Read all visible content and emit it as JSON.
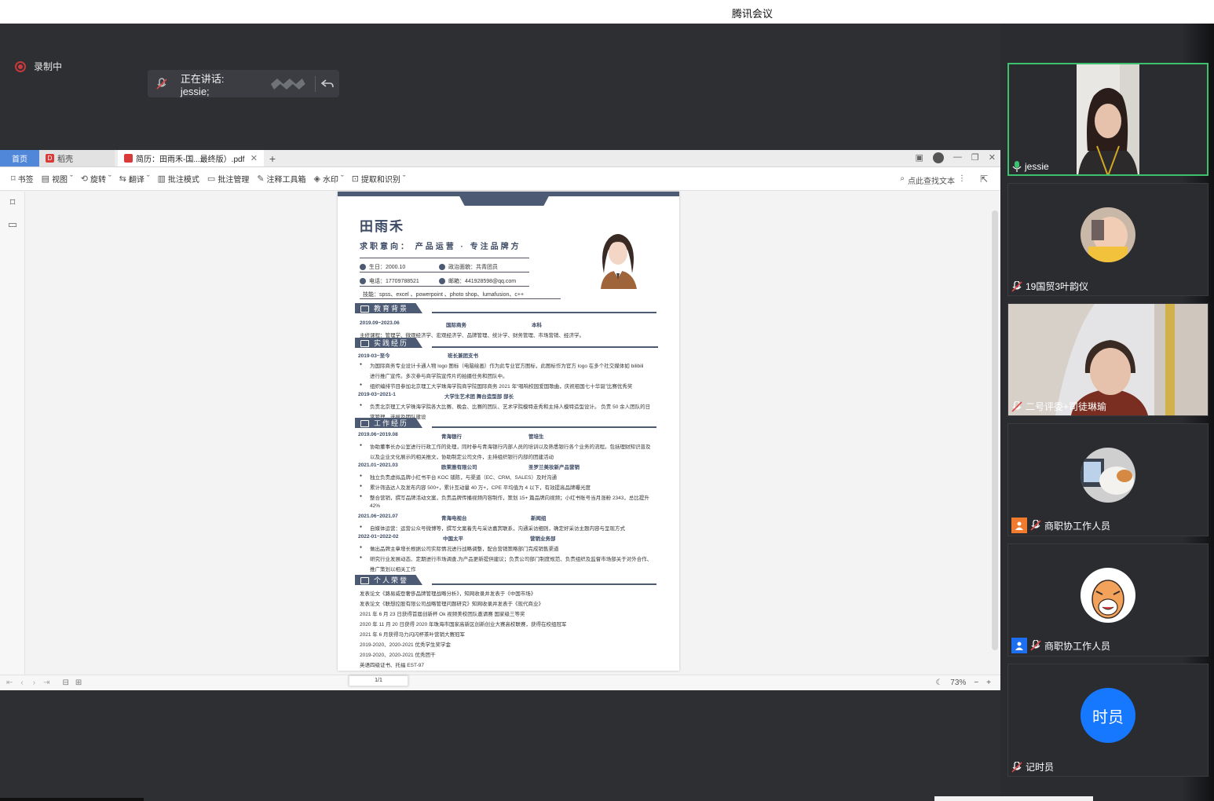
{
  "app": {
    "title": "腾讯会议"
  },
  "recording": {
    "label": "录制中"
  },
  "speaking": {
    "label": "正在讲话: jessie;"
  },
  "viewer": {
    "tabs": {
      "home": "首页",
      "daoke": "稻壳",
      "pdf": "简历：田雨禾-国...最终版）.pdf"
    },
    "toolbar": {
      "bookmark": "书签",
      "view": "视图",
      "rotate": "旋转",
      "translate": "翻译",
      "annotate_mode": "批注模式",
      "annotate_manage": "批注管理",
      "annotate_tools": "注释工具箱",
      "watermark": "水印",
      "extract": "提取和识别",
      "search": "点此查找文本"
    },
    "status": {
      "page": "1/1",
      "zoom": "73%"
    }
  },
  "resume": {
    "name": "田雨禾",
    "intent": "求职意向：  产品运营 · 专注品牌方",
    "birth": "生日：2000.10",
    "politics": "政治面貌：共青团员",
    "phone": "电话：17709788521",
    "email": "邮箱：441928598@qq.com",
    "skills": "技能：spss、excel 、powerpoint 、photo shop、lumafusion、c++",
    "sections": {
      "education": "教育背景",
      "practice": "实践经历",
      "work": "工作经历",
      "honors": "个人荣誉"
    },
    "edu": {
      "period": "2019.09~2023.06",
      "major": "国际商务",
      "degree": "本科",
      "courses": "主修课程：管理学、微观经济学、宏观经济学、品牌管理、统计学、财务管理、市场营销、经济学。"
    },
    "practice": [
      {
        "period": "2019-03~至今",
        "role": "班长兼团支书"
      },
      {
        "text1": "为国际商务专业设计卡通人物 logo 图标（电脑绘画）作为此专业官方图标，此图标作为官方 logo 在多个社交媒体如 bilibili"
      },
      {
        "text2": "进行推广宣传。多次参与商学院宣传片的拍摄任务和团队中。"
      },
      {
        "text3": "组织编排节目参加北京理工大学珠海学院商学院国际商务 2021 年“唱响校园爱国歌曲，庆祝祖国七十华诞”比赛优秀奖"
      },
      {
        "period": "2019-03~2021-1",
        "role": "大学生艺术团  舞台造型部  部长"
      },
      {
        "text4": "负责北京理工大学珠海学院各大比赛、晚会、比赛的团队、艺术学院模特走秀和主持人模特造型设计。  负责 50 余人团队的日"
      },
      {
        "text5": "常管理、选拔及团队建设"
      }
    ],
    "work": [
      {
        "period": "2019.06~2019.08",
        "company": "青海银行",
        "role": "管培生"
      },
      {
        "t1": "协助董事长办公室进行行政工作的处理，同时参与青海银行内部人员的培训以及熟悉银行各个业务的流程。包括理财知识普及"
      },
      {
        "t2": "以及企业文化展示的相关推文，协助制定公司文件，主持组织银行内部的团建活动"
      },
      {
        "period": "2021.01~2021.03",
        "company": "欧莱雅有限公司",
        "role": "圣罗兰美妆新产品营销"
      },
      {
        "t3": "独立负责虚拟品牌小红书平台 KOC 铺陈，与渠道（EC、CRM、SALES）及时沟通"
      },
      {
        "t4": "累计筛选达人及发布内容 500+，累计互动量 40 万+，CPE 平均值为 4 以下，有效提高品牌曝光度"
      },
      {
        "t5": "整合营销，撰写品牌活动文案，负责品牌传播视频内容制作，策划 15+ 篇品牌向视频；小红书账号当月涨粉 2343，总比提升"
      },
      {
        "t6": "42%"
      },
      {
        "period": "2021.06~2021.07",
        "company": "青海电视台",
        "role": "新闻组"
      },
      {
        "t7": "自媒体运营：运营公众号微博等，撰写文案着先与采访嘉宾联系，沟通采访细则，确定好采访主题内容与呈现方式"
      },
      {
        "period": "2022-01~2022-02",
        "company": "中国太平",
        "role": "营销业务部"
      },
      {
        "t8": "做出品牌主章增长根据公司实际情况进行战略调整，配合营销策略部门完成销售渠道"
      },
      {
        "t9": "研究行业发展动态、定期进行市场调查,为产品更新提供建议；负责公司部门制度规范、负责组织及监督市场部关于对外合作、"
      },
      {
        "t10": "推广策划以相关工作"
      }
    ],
    "honors": [
      "发表论文《路易威登奢侈品牌管理战略分析》，知网收录并发表于《中国市场》",
      "发表论文《联想控股有限公司战略管理问题研究》知网收录并发表于《现代商业》",
      "2021 年 6 月 23 日获得首届创新杯 Ok 视频美校团队邀请赛 国家级三等奖",
      "2020 年 11 月 20 日获得 2020 年珠海市国家高新区创新创业大赛高校联赛，获得在校组冠军",
      "2021 年 6 月获得马力闪闪杯茶叶营销大赛冠军",
      "2019-2020、2020-2021 优秀学生奖学金",
      "2019-2020、2020-2021 优秀团干",
      "英语四级证书、托福 EST-97"
    ]
  },
  "participants": [
    {
      "name": "jessie"
    },
    {
      "name": "19国贸3叶韵仪"
    },
    {
      "name": "二号评委+司徒琳瑜"
    },
    {
      "name": "商职协工作人员"
    },
    {
      "name": "商职协工作人员"
    },
    {
      "name": "记时员",
      "initials": "时员"
    }
  ],
  "colors": {
    "accent": "#4c5a74",
    "active_border": "#3ec16e",
    "avatar_blue": "#1677ff"
  }
}
